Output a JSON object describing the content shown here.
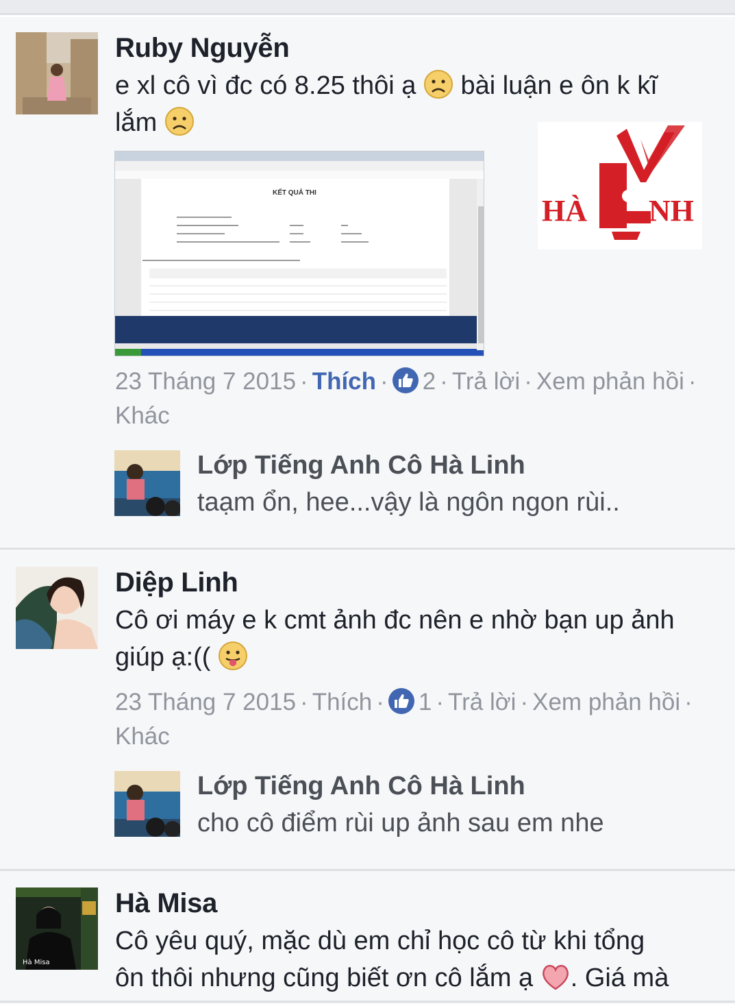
{
  "comments": [
    {
      "author": "Ruby Nguyễn",
      "text_1": "e xl cô vì đc có 8.25 thôi ạ ",
      "text_2": " bài luận e ôn k kĩ",
      "text_3": "lắm ",
      "emoji_1": "sad-face-icon",
      "emoji_2": "sad-face-icon",
      "meta": {
        "date": "23 Tháng 7 2015",
        "like_label": "Thích",
        "like_count": "2",
        "reply_label": "Trả lời",
        "view_replies_label": "Xem phản hồi",
        "more_label": "Khác"
      },
      "attachment": {
        "screenshot_title": "KẾT QUẢ THI",
        "logo_text_left": "HÀ",
        "logo_text_right": "NH"
      },
      "reply": {
        "author": "Lớp Tiếng Anh Cô Hà Linh",
        "text": "taạm ổn, hee...vậy là ngôn ngon rùi.."
      }
    },
    {
      "author": "Diệp Linh",
      "text_1": "Cô ơi máy e k cmt ảnh đc nên e nhờ bạn up ảnh",
      "text_2": "giúp ạ:(( ",
      "emoji_1": "tongue-out-face-icon",
      "meta": {
        "date": "23 Tháng 7 2015",
        "like_label": "Thích",
        "like_count": "1",
        "reply_label": "Trả lời",
        "view_replies_label": "Xem phản hồi",
        "more_label": "Khác"
      },
      "reply": {
        "author": "Lớp Tiếng Anh Cô Hà Linh",
        "text": "cho cô điểm rùi up ảnh sau em nhe"
      }
    },
    {
      "author": "Hà Misa",
      "text_1": "Cô yêu quý, mặc dù em chỉ học cô từ khi tổng",
      "text_2": "ôn thôi nhưng cũng biết ơn cô lắm ạ ",
      "text_3": ". Giá mà",
      "emoji_1": "heart-icon"
    }
  ],
  "colors": {
    "background": "#f6f7f9",
    "link_blue": "#4267b2",
    "meta_grey": "#90949c",
    "divider": "#dddfe2"
  }
}
